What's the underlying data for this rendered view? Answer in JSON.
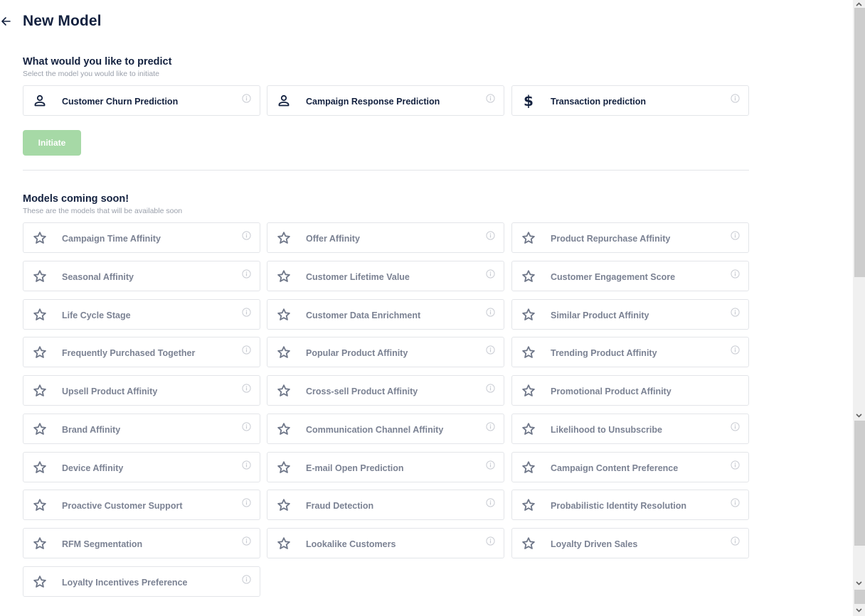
{
  "header": {
    "title": "New Model",
    "back_icon": "arrow-left-icon"
  },
  "predict_section": {
    "title": "What would you like to predict",
    "subtitle": "Select the model you would like to initiate",
    "models": [
      {
        "label": "Customer Churn Prediction",
        "icon": "user-icon",
        "info": true
      },
      {
        "label": "Campaign Response Prediction",
        "icon": "user-icon",
        "info": true
      },
      {
        "label": "Transaction prediction",
        "icon": "dollar-icon",
        "info": true
      }
    ],
    "initiate_label": "Initiate",
    "initiate_disabled": true
  },
  "coming_soon_section": {
    "title": "Models coming soon!",
    "subtitle": "These are the models that will be available soon",
    "models": [
      {
        "label": "Campaign Time Affinity",
        "info": true
      },
      {
        "label": "Offer Affinity",
        "info": true
      },
      {
        "label": "Product Repurchase Affinity",
        "info": true
      },
      {
        "label": "Seasonal Affinity",
        "info": true
      },
      {
        "label": "Customer Lifetime Value",
        "info": true
      },
      {
        "label": "Customer Engagement Score",
        "info": true
      },
      {
        "label": "Life Cycle Stage",
        "info": true
      },
      {
        "label": "Customer Data Enrichment",
        "info": true
      },
      {
        "label": "Similar Product Affinity",
        "info": true
      },
      {
        "label": "Frequently Purchased Together",
        "info": true
      },
      {
        "label": "Popular Product Affinity",
        "info": true
      },
      {
        "label": "Trending Product Affinity",
        "info": true
      },
      {
        "label": "Upsell Product Affinity",
        "info": true
      },
      {
        "label": "Cross-sell Product Affinity",
        "info": true
      },
      {
        "label": "Promotional Product Affinity",
        "info": false
      },
      {
        "label": "Brand Affinity",
        "info": true
      },
      {
        "label": "Communication Channel Affinity",
        "info": true
      },
      {
        "label": "Likelihood to Unsubscribe",
        "info": true
      },
      {
        "label": "Device Affinity",
        "info": true
      },
      {
        "label": "E-mail Open Prediction",
        "info": true
      },
      {
        "label": "Campaign Content Preference",
        "info": true
      },
      {
        "label": "Proactive Customer Support",
        "info": true
      },
      {
        "label": "Fraud Detection",
        "info": true
      },
      {
        "label": "Probabilistic Identity Resolution",
        "info": true
      },
      {
        "label": "RFM Segmentation",
        "info": true
      },
      {
        "label": "Lookalike Customers",
        "info": true
      },
      {
        "label": "Loyalty Driven Sales",
        "info": true
      },
      {
        "label": "Loyalty Incentives Preference",
        "info": true
      }
    ]
  },
  "colors": {
    "primary_text": "#13213f",
    "muted_text": "#7b8293",
    "subtitle_text": "#9aa0ab",
    "initiate_disabled_bg": "#a6d9a6",
    "card_border": "#e3e5e9"
  }
}
